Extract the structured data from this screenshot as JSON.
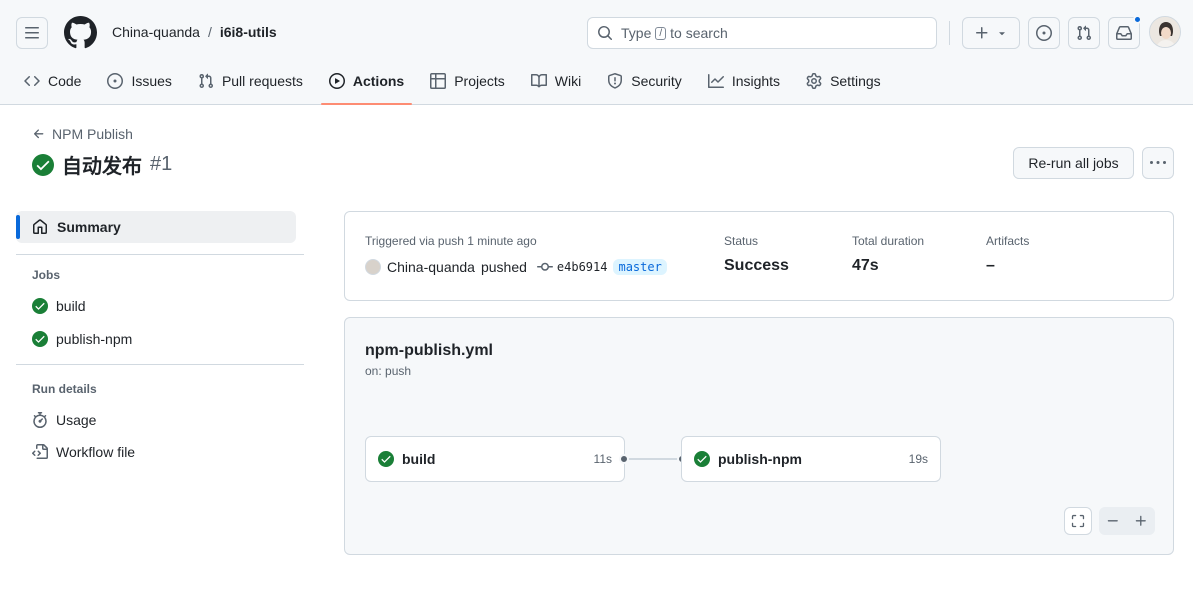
{
  "header": {
    "owner": "China-quanda",
    "separator": "/",
    "repo": "i6i8-utils",
    "search": {
      "prefix": "Type",
      "key": "/",
      "suffix": "to search"
    }
  },
  "tabs": [
    {
      "label": "Code",
      "icon": "code-icon"
    },
    {
      "label": "Issues",
      "icon": "issue-opened-icon"
    },
    {
      "label": "Pull requests",
      "icon": "git-pull-request-icon"
    },
    {
      "label": "Actions",
      "icon": "play-icon",
      "active": true
    },
    {
      "label": "Projects",
      "icon": "table-icon"
    },
    {
      "label": "Wiki",
      "icon": "book-icon"
    },
    {
      "label": "Security",
      "icon": "shield-icon"
    },
    {
      "label": "Insights",
      "icon": "graph-icon"
    },
    {
      "label": "Settings",
      "icon": "gear-icon"
    }
  ],
  "run": {
    "back_label": "NPM Publish",
    "title": "自动发布",
    "number": "#1",
    "rerun_label": "Re-run all jobs"
  },
  "sidebar": {
    "summary_label": "Summary",
    "jobs_heading": "Jobs",
    "jobs": [
      {
        "label": "build"
      },
      {
        "label": "publish-npm"
      }
    ],
    "details_heading": "Run details",
    "details": [
      {
        "label": "Usage",
        "icon": "stopwatch-icon"
      },
      {
        "label": "Workflow file",
        "icon": "file-code-icon"
      }
    ]
  },
  "summary": {
    "trigger_label": "Triggered via push 1 minute ago",
    "actor": "China-quanda",
    "action": "pushed",
    "commit": "e4b6914",
    "branch": "master",
    "status_label": "Status",
    "status_value": "Success",
    "duration_label": "Total duration",
    "duration_value": "47s",
    "artifacts_label": "Artifacts",
    "artifacts_value": "–"
  },
  "workflow": {
    "file": "npm-publish.yml",
    "trigger": "on: push",
    "jobs": [
      {
        "name": "build",
        "duration": "11s"
      },
      {
        "name": "publish-npm",
        "duration": "19s"
      }
    ]
  },
  "colors": {
    "success": "#1a7f37",
    "accent": "#0969da",
    "tab_underline": "#fd8c73",
    "notification": "#0969da"
  }
}
